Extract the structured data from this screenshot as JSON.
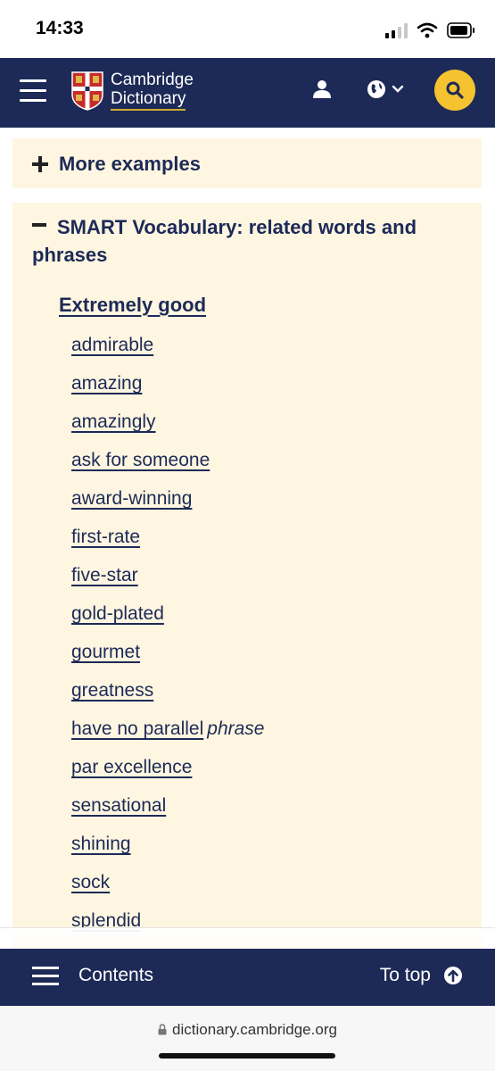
{
  "status": {
    "time": "14:33"
  },
  "header": {
    "brand_line1": "Cambridge",
    "brand_line2": "Dictionary",
    "accent_color": "#f5c330",
    "bar_color": "#1d2a57"
  },
  "more_examples": {
    "label": "More examples",
    "icon": "plus-icon"
  },
  "smart_vocab": {
    "title": "SMART Vocabulary: related words and phrases",
    "icon": "minus-icon",
    "category": "Extremely good",
    "panel_color": "#fef6e1",
    "words": [
      {
        "word": "admirable"
      },
      {
        "word": "amazing"
      },
      {
        "word": "amazingly"
      },
      {
        "word": "ask for someone"
      },
      {
        "word": "award-winning"
      },
      {
        "word": "first-rate"
      },
      {
        "word": "five-star"
      },
      {
        "word": "gold-plated"
      },
      {
        "word": "gourmet"
      },
      {
        "word": "greatness"
      },
      {
        "word": "have no parallel",
        "pos": "phrase"
      },
      {
        "word": "par excellence"
      },
      {
        "word": "sensational"
      },
      {
        "word": "shining"
      },
      {
        "word": "sock"
      },
      {
        "word": "splendid"
      }
    ]
  },
  "bottom_bar": {
    "contents_label": "Contents",
    "to_top_label": "To top"
  },
  "browser": {
    "url": "dictionary.cambridge.org"
  }
}
